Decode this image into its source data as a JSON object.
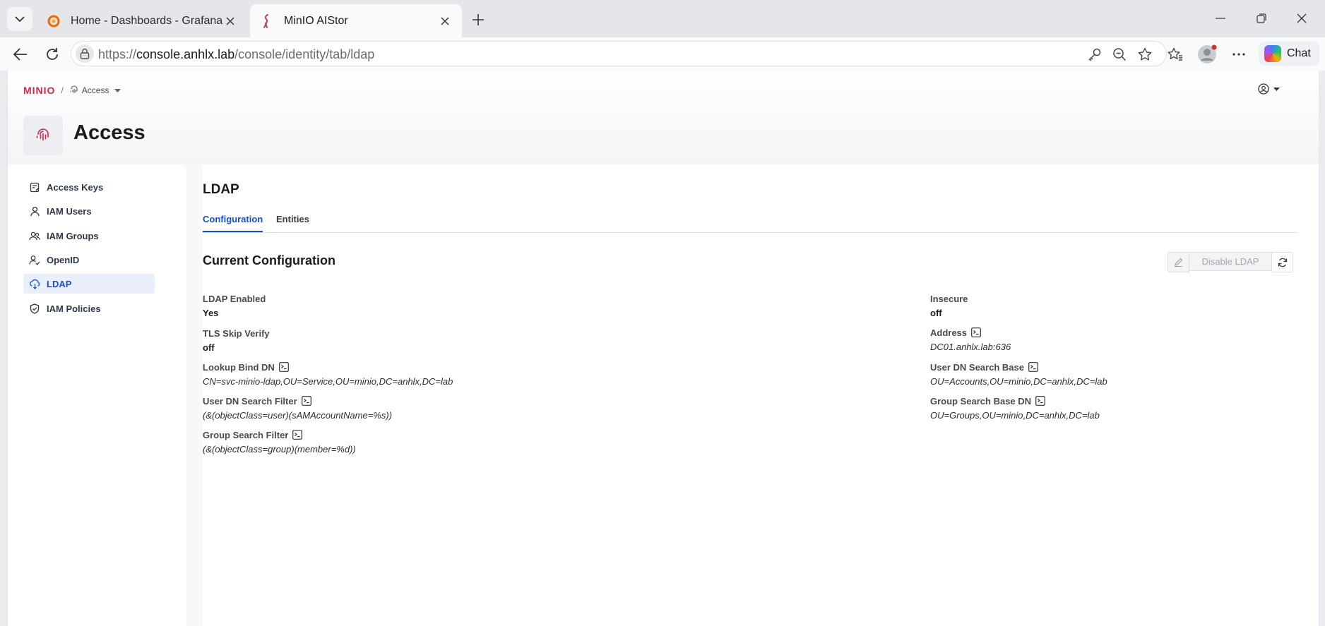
{
  "browser": {
    "tabs": [
      {
        "title": "Home - Dashboards - Grafana",
        "favicon": "grafana-icon"
      },
      {
        "title": "MinIO AIStor",
        "favicon": "minio-flamingo-icon"
      }
    ],
    "url_scheme": "https://",
    "url_host": "console.anhlx.lab",
    "url_path": "/console/identity/tab/ldap",
    "chat_label": "Chat"
  },
  "header": {
    "logo_text": "MINIO",
    "breadcrumb_separator": "/",
    "breadcrumb_section": "Access",
    "page_title": "Access"
  },
  "sidebar": {
    "items": [
      {
        "label": "Access Keys",
        "icon": "access-keys-icon",
        "active": false
      },
      {
        "label": "IAM Users",
        "icon": "user-icon",
        "active": false
      },
      {
        "label": "IAM Groups",
        "icon": "group-icon",
        "active": false
      },
      {
        "label": "OpenID",
        "icon": "openid-icon",
        "active": false
      },
      {
        "label": "LDAP",
        "icon": "ldap-icon",
        "active": true
      },
      {
        "label": "IAM Policies",
        "icon": "shield-icon",
        "active": false
      }
    ]
  },
  "main": {
    "section_title": "LDAP",
    "tabs": [
      {
        "label": "Configuration",
        "active": true
      },
      {
        "label": "Entities",
        "active": false
      }
    ],
    "config_title": "Current Configuration",
    "disable_button": "Disable LDAP",
    "fields_left": [
      {
        "label": "LDAP Enabled",
        "value": "Yes",
        "style": "plain",
        "has_term_icon": false
      },
      {
        "label": "TLS Skip Verify",
        "value": "off",
        "style": "plain",
        "has_term_icon": false
      },
      {
        "label": "Lookup Bind DN",
        "value": "CN=svc-minio-ldap,OU=Service,OU=minio,DC=anhlx,DC=lab",
        "style": "code",
        "has_term_icon": true
      },
      {
        "label": "User DN Search Filter",
        "value": "(&(objectClass=user)(sAMAccountName=%s))",
        "style": "code",
        "has_term_icon": true
      },
      {
        "label": "Group Search Filter",
        "value": "(&(objectClass=group)(member=%d))",
        "style": "code",
        "has_term_icon": true
      }
    ],
    "fields_right": [
      {
        "label": "Insecure",
        "value": "off",
        "style": "plain",
        "has_term_icon": false
      },
      {
        "label": "Address",
        "value": "DC01.anhlx.lab:636",
        "style": "code",
        "has_term_icon": true
      },
      {
        "label": "User DN Search Base",
        "value": "OU=Accounts,OU=minio,DC=anhlx,DC=lab",
        "style": "code",
        "has_term_icon": true
      },
      {
        "label": "Group Search Base DN",
        "value": "OU=Groups,OU=minio,DC=anhlx,DC=lab",
        "style": "code",
        "has_term_icon": true
      }
    ]
  },
  "colors": {
    "accent": "#1a4fc4",
    "brand": "#c72c48",
    "active_nav_bg": "#eaf0fb"
  }
}
